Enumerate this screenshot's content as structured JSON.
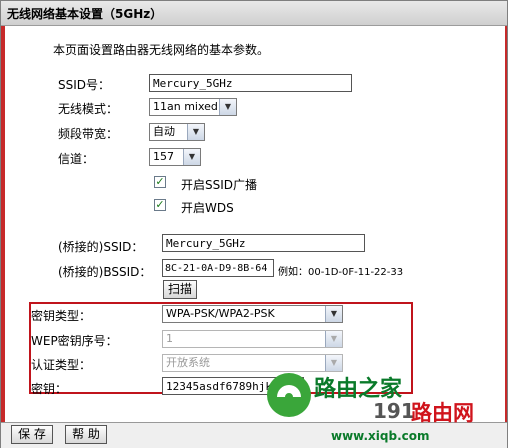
{
  "title": "无线网络基本设置（5GHz）",
  "intro": "本页面设置路由器无线网络的基本参数。",
  "ssid": {
    "label": "SSID号：",
    "value": "Mercury_5GHz"
  },
  "mode": {
    "label": "无线模式：",
    "value": "11an mixed"
  },
  "bandwidth": {
    "label": "频段带宽：",
    "value": "自动"
  },
  "channel": {
    "label": "信道：",
    "value": "157"
  },
  "enable_ssid_broadcast": {
    "label": "开启SSID广播",
    "checked": true
  },
  "enable_wds": {
    "label": "开启WDS",
    "checked": true
  },
  "bridge_ssid": {
    "label": "(桥接的)SSID：",
    "value": "Mercury_5GHz"
  },
  "bridge_bssid": {
    "label": "(桥接的)BSSID：",
    "value": "8C-21-0A-D9-8B-64",
    "example": "例如：00-1D-0F-11-22-33"
  },
  "scan_button": "扫描",
  "key_type": {
    "label": "密钥类型：",
    "value": "WPA-PSK/WPA2-PSK"
  },
  "wep_index": {
    "label": "WEP密钥序号：",
    "value": "1"
  },
  "auth_type": {
    "label": "认证类型：",
    "value": "开放系统"
  },
  "key": {
    "label": "密钥：",
    "value": "12345asdf6789hjkl"
  },
  "save_button": "保 存",
  "help_button": "帮 助",
  "watermark": {
    "brand": "路由之家",
    "site_number": "191",
    "site_name": "路由网",
    "url": "www.xiqb.com"
  },
  "colors": {
    "accent_red": "#c0141c",
    "watermark_green": "#3aa63a",
    "watermark_text": "#0a7a2a"
  }
}
